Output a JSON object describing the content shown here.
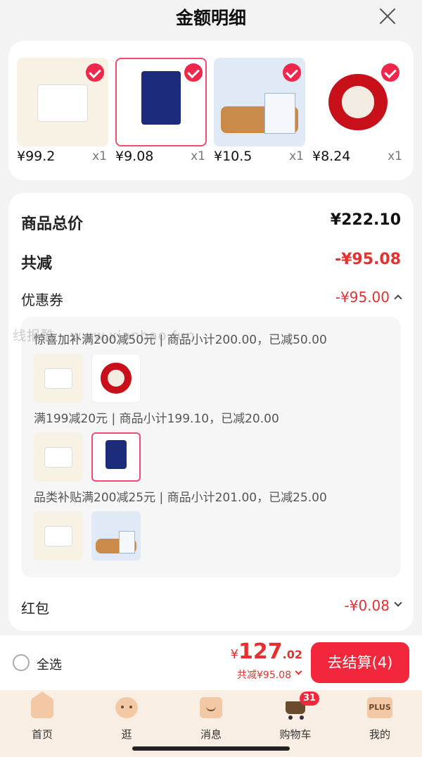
{
  "header": {
    "title": "金额明细"
  },
  "products": [
    {
      "price": "¥99.2",
      "qty": "x1",
      "alt": "cat-litter-box"
    },
    {
      "price": "¥9.08",
      "qty": "x1",
      "alt": "deodorant-bag"
    },
    {
      "price": "¥10.5",
      "qty": "x1",
      "alt": "cat-food-bag"
    },
    {
      "price": "¥8.24",
      "qty": "x1",
      "alt": "red-thread-spool"
    }
  ],
  "summary": {
    "total_label": "商品总价",
    "total_value": "¥222.10",
    "reduce_label": "共减",
    "reduce_value": "-¥95.08",
    "coupon_label": "优惠券",
    "coupon_value": "-¥95.00",
    "redpack_label": "红包",
    "redpack_value": "-¥0.08"
  },
  "promos": [
    {
      "text": "惊喜加补满200减50元 | 商品小计200.00，已减50.00"
    },
    {
      "text": "满199减20元 | 商品小计199.10，已减20.00"
    },
    {
      "text": "品类补贴满200减25元 | 商品小计201.00，已减25.00"
    }
  ],
  "watermark": "线报酷 - www.xianbao.fun",
  "bottom": {
    "select_all": "全选",
    "currency": "¥",
    "price_int": "127",
    "price_dec": ".02",
    "reduce_text": "共减¥95.08",
    "checkout_label": "去结算(4)"
  },
  "tabs": [
    {
      "label": "首页",
      "icon": "home-icon"
    },
    {
      "label": "逛",
      "icon": "browse-icon"
    },
    {
      "label": "消息",
      "icon": "message-icon"
    },
    {
      "label": "购物车",
      "icon": "cart-icon",
      "badge": "31"
    },
    {
      "label": "我的",
      "icon": "plus-profile-icon",
      "icon_text": "PLUS"
    }
  ]
}
